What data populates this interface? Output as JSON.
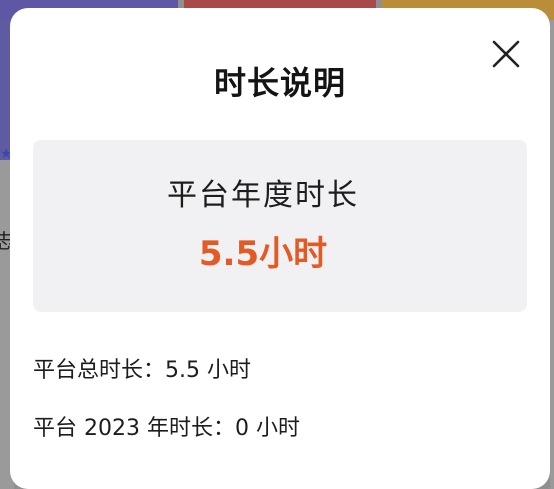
{
  "dialog": {
    "title": "时长说明",
    "close_icon": "close-icon",
    "card": {
      "label": "平台年度时长",
      "value": "5.5小时",
      "value_color": "#e35a25"
    },
    "details": [
      {
        "text": "平台总时长：5.5 小时"
      },
      {
        "text": "平台 2023 年时长：0 小时"
      }
    ]
  }
}
